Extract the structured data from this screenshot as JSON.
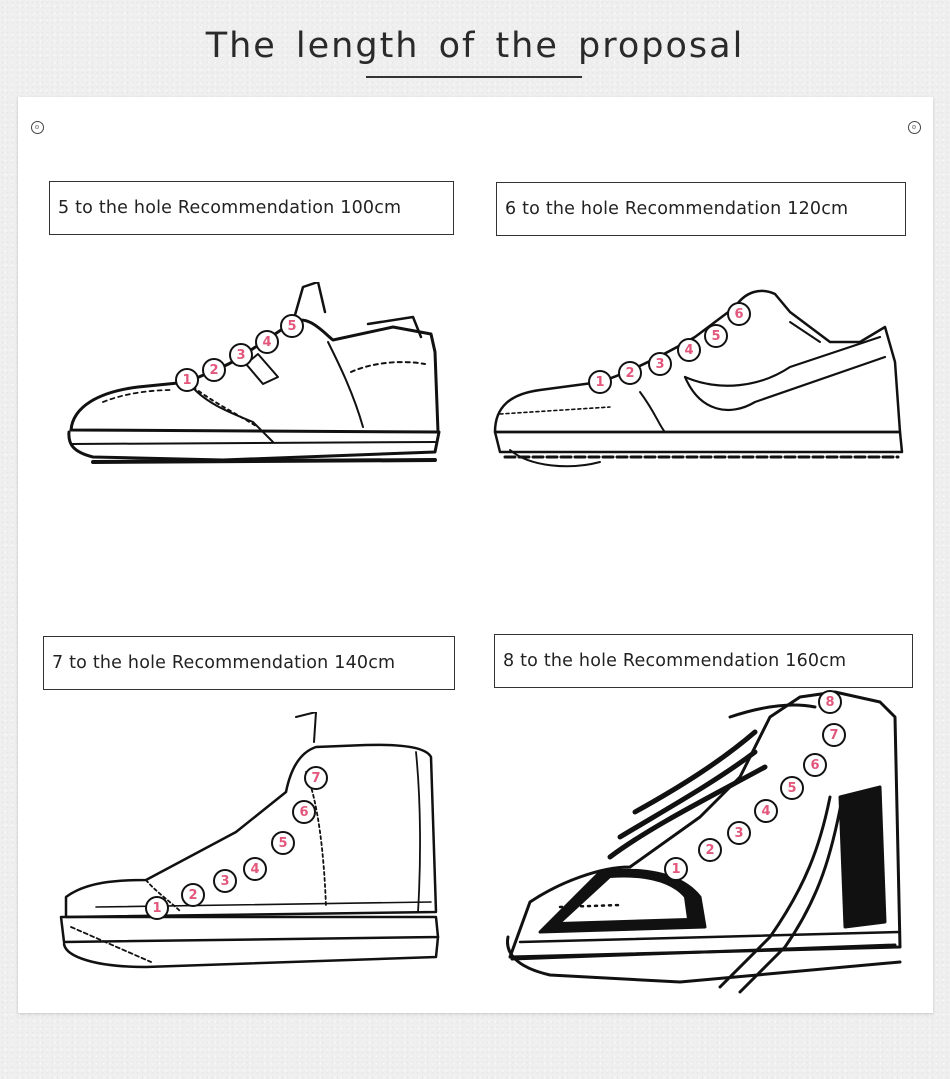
{
  "title": "The length of the proposal",
  "panels": [
    {
      "label": "5 to the hole Recommendation 100cm",
      "holes": [
        "1",
        "2",
        "3",
        "4",
        "5"
      ]
    },
    {
      "label": "6 to the hole Recommendation 120cm",
      "holes": [
        "1",
        "2",
        "3",
        "4",
        "5",
        "6"
      ]
    },
    {
      "label": "7 to the hole Recommendation 140cm",
      "holes": [
        "1",
        "2",
        "3",
        "4",
        "5",
        "6",
        "7"
      ]
    },
    {
      "label": "8 to the hole Recommendation 160cm",
      "holes": [
        "1",
        "2",
        "3",
        "4",
        "5",
        "6",
        "7",
        "8"
      ]
    }
  ],
  "colors": {
    "hole_marker": "#e3577c",
    "line": "#111111"
  }
}
